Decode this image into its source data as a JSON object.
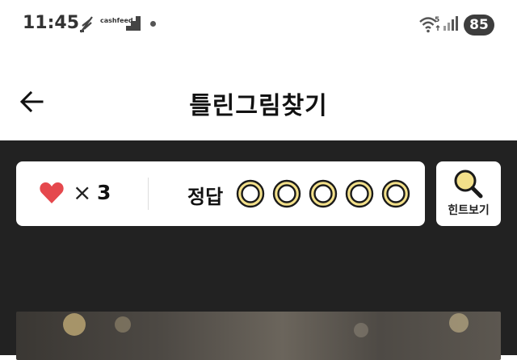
{
  "status_bar": {
    "time": "11:45",
    "notification_app": "cashfeed",
    "signal_label": "5",
    "battery": "85"
  },
  "header": {
    "back_icon": "arrow-left-icon",
    "title": "틀린그림찾기"
  },
  "game": {
    "lives_icon": "heart-icon",
    "lives_multiplier": "×",
    "lives_count": "3",
    "answer_label": "정답",
    "answer_slots_total": 5,
    "answer_slots_found": 0,
    "hint_icon": "magnifier-icon",
    "hint_label": "힌트보기"
  },
  "colors": {
    "game_background": "#222222",
    "heart": "#e5484d",
    "slot_fill": "#f3e08a",
    "slot_border": "#1a1a1a"
  }
}
